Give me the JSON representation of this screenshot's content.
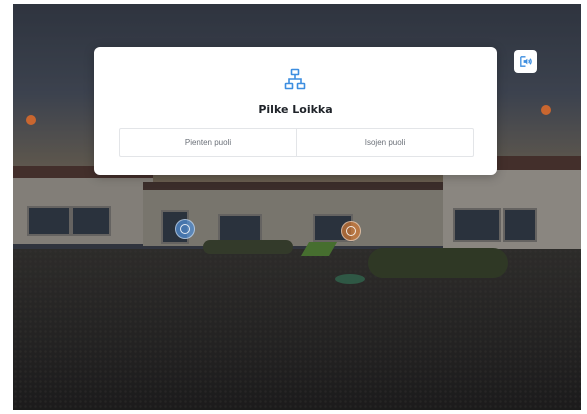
{
  "title": "Pilke Loikka",
  "buttons": {
    "left_label": "Pienten puoli",
    "right_label": "Isojen puoli"
  },
  "icons": {
    "dialog_icon": "sitemap-icon",
    "audio_button": "audio-description-icon",
    "hotspot_blue": "navigation-hotspot-icon",
    "hotspot_orange": "navigation-hotspot-icon"
  },
  "colors": {
    "accent": "#3d8ee0",
    "marker": "#c9662f",
    "dialog_background": "#ffffff"
  }
}
